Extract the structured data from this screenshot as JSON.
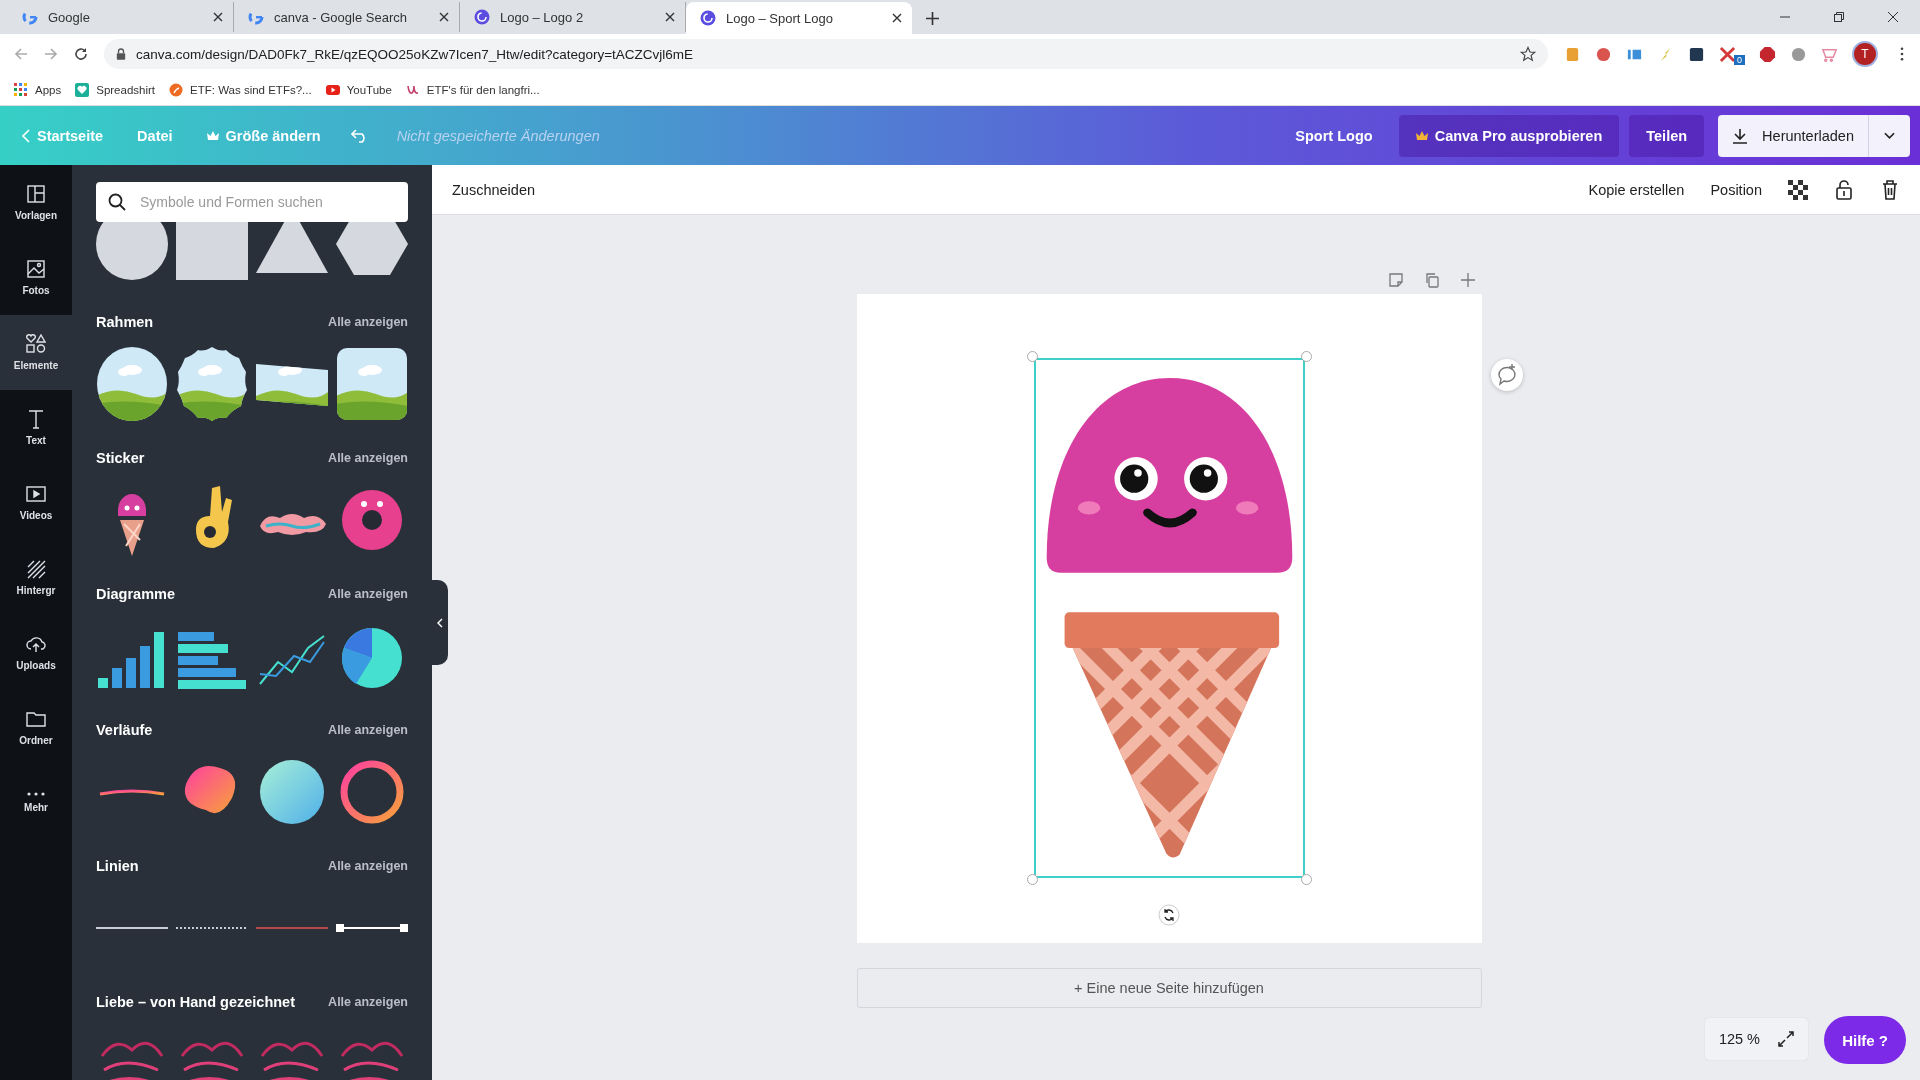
{
  "browser": {
    "tabs": [
      {
        "title": "Google",
        "kind": "google",
        "selected": false
      },
      {
        "title": "canva - Google Search",
        "kind": "google",
        "selected": false
      },
      {
        "title": "Logo – Logo 2",
        "kind": "canva",
        "selected": false
      },
      {
        "title": "Logo – Sport Logo",
        "kind": "canva",
        "selected": true
      }
    ],
    "url": "canva.com/design/DAD0Fk7_RkE/qzEQOO25oKZw7Icen7_Htw/edit?category=tACZCvjl6mE",
    "bookmarks": [
      {
        "label": "Apps",
        "kind": "apps"
      },
      {
        "label": "Spreadshirt",
        "kind": "spreadshirt"
      },
      {
        "label": "ETF: Was sind ETFs?...",
        "kind": "etf"
      },
      {
        "label": "YouTube",
        "kind": "youtube"
      },
      {
        "label": "ETF's für den langfri...",
        "kind": "letter"
      }
    ],
    "extension_badge": "0",
    "avatar": "T"
  },
  "header": {
    "back": "Startseite",
    "file": "Datei",
    "resize": "Größe ändern",
    "status": "Nicht gespeicherte Änderungen",
    "design_title": "Sport Logo",
    "pro": "Canva Pro ausprobieren",
    "share": "Teilen",
    "download": "Herunterladen"
  },
  "rail": [
    {
      "label": "Vorlagen",
      "kind": "templates",
      "selected": false
    },
    {
      "label": "Fotos",
      "kind": "photos",
      "selected": false
    },
    {
      "label": "Elemente",
      "kind": "elements",
      "selected": true
    },
    {
      "label": "Text",
      "kind": "text",
      "selected": false
    },
    {
      "label": "Videos",
      "kind": "videos",
      "selected": false
    },
    {
      "label": "Hintergr",
      "kind": "background",
      "selected": false
    },
    {
      "label": "Uploads",
      "kind": "uploads",
      "selected": false
    },
    {
      "label": "Ordner",
      "kind": "folder",
      "selected": false
    },
    {
      "label": "Mehr",
      "kind": "more",
      "selected": false
    }
  ],
  "panel": {
    "search": {
      "placeholder": "Symbole und Formen suchen"
    },
    "sections": [
      {
        "kind": "shapes"
      },
      {
        "title": "Rahmen",
        "link": "Alle anzeigen",
        "kind": "frames"
      },
      {
        "title": "Sticker",
        "link": "Alle anzeigen",
        "kind": "stickers"
      },
      {
        "title": "Diagramme",
        "link": "Alle anzeigen",
        "kind": "charts"
      },
      {
        "title": "Verläufe",
        "link": "Alle anzeigen",
        "kind": "gradients"
      },
      {
        "title": "Linien",
        "link": "Alle anzeigen",
        "kind": "lines"
      },
      {
        "title": "Liebe – von Hand gezeichnet",
        "link": "Alle anzeigen",
        "kind": "lettering"
      }
    ]
  },
  "toolbar": {
    "crop": "Zuschneiden",
    "duplicate": "Kopie erstellen",
    "position": "Position"
  },
  "canvas": {
    "add_page": "+ Eine neue Seite hinzufügen",
    "zoom": "125 %",
    "help": "Hilfe",
    "help_icon": "?"
  }
}
